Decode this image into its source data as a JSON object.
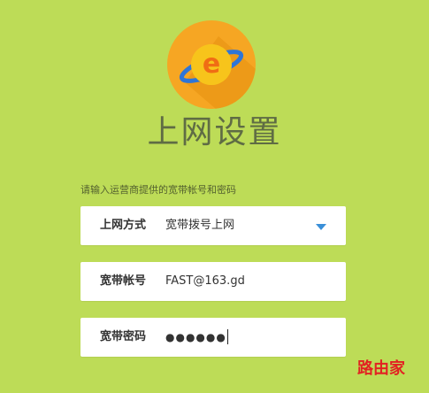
{
  "page": {
    "title": "上网设置",
    "instruction": "请输入运营商提供的宽带帐号和密码"
  },
  "colors": {
    "background": "#bddc57",
    "logo_circle": "#f6a623",
    "logo_planet": "#f7c41b",
    "logo_ring": "#2f75d6",
    "logo_letter": "#f06d14",
    "dropdown_arrow": "#3a8fd8",
    "watermark": "#e22222"
  },
  "icons": {
    "logo": "planet-e-icon",
    "dropdown": "triangle-down-icon"
  },
  "form": {
    "connection_type": {
      "label": "上网方式",
      "value": "宽带拨号上网"
    },
    "account": {
      "label": "宽带帐号",
      "value": "FAST@163.gd"
    },
    "password": {
      "label": "宽带密码",
      "value": "●●●●●●"
    }
  },
  "watermark": {
    "text": "路由家"
  }
}
